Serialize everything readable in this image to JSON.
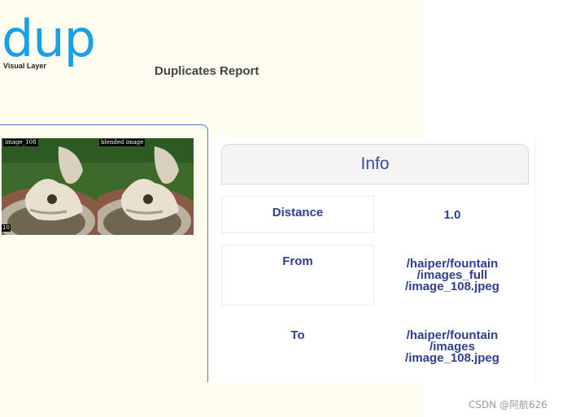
{
  "brand": {
    "logo_text": "dup",
    "tagline": "Visual Layer",
    "accent": "#1aa0e6"
  },
  "report": {
    "title": "Duplicates Report"
  },
  "thumbnails": [
    {
      "label": "image_108",
      "corner": "10"
    },
    {
      "label": "blended image",
      "corner": ""
    }
  ],
  "info": {
    "header": "Info",
    "rows": [
      {
        "key": "Distance",
        "value": [
          "1.0"
        ]
      },
      {
        "key": "From",
        "value": [
          "/haiper/fountain",
          "/images_full",
          "/image_108.jpeg"
        ]
      },
      {
        "key": "To",
        "value": [
          "/haiper/fountain",
          "/images",
          "/image_108.jpeg"
        ]
      }
    ]
  },
  "watermark": "CSDN @阿航626"
}
